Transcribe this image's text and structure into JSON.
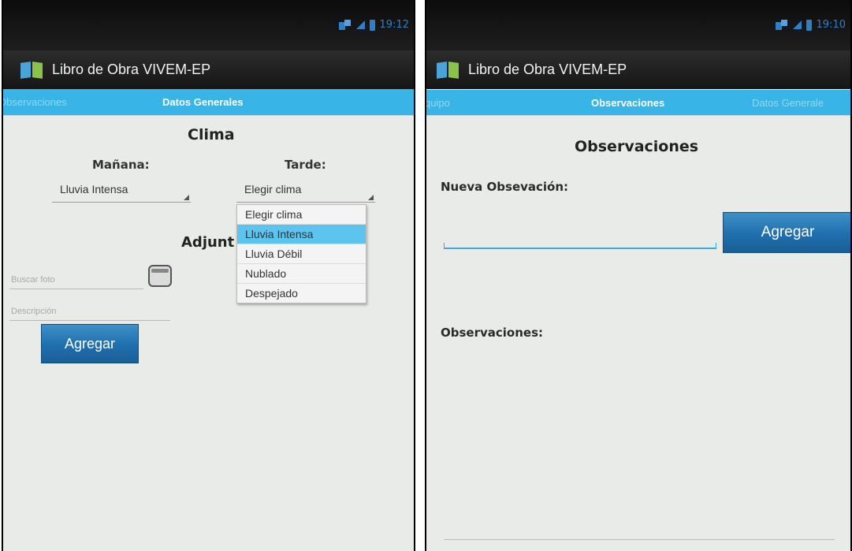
{
  "left": {
    "status": {
      "time": "19:12"
    },
    "app_title": "Libro de Obra VIVEM-EP",
    "tabs": [
      {
        "label": "Observaciones",
        "active": false
      },
      {
        "label": "Datos Generales",
        "active": true
      }
    ],
    "clima_title": "Clima",
    "manana_label": "Mañana:",
    "tarde_label": "Tarde:",
    "manana_value": "Lluvia Intensa",
    "tarde_value": "Elegir clima",
    "dropdown_options": [
      "Elegir clima",
      "Lluvia Intensa",
      "Lluvia Débil",
      "Nublado",
      "Despejado"
    ],
    "dropdown_selected": "Lluvia Intensa",
    "adjuntos_title": "Adjunt",
    "buscar_placeholder": "Buscar foto",
    "descripcion_placeholder": "Descripción",
    "agregar_label": "Agregar"
  },
  "right": {
    "status": {
      "time": "19:10"
    },
    "app_title": "Libro de Obra VIVEM-EP",
    "tabs": [
      {
        "label": "quipo",
        "active": false
      },
      {
        "label": "Observaciones",
        "active": true
      },
      {
        "label": "Datos Generale",
        "active": false
      }
    ],
    "page_title": "Observaciones",
    "nueva_label": "Nueva Obsevación:",
    "agregar_label": "Agregar",
    "observaciones_label": "Observaciones:"
  },
  "colors": {
    "tab_strip": "#38b5e6",
    "status_icons": "#2f7fc7",
    "button": "#1f6fae",
    "screen_bg": "#e9ebe9"
  },
  "icons": [
    "data-icon",
    "signal-icon",
    "battery-icon",
    "app-icon",
    "calendar-icon",
    "spinner-arrow-icon"
  ]
}
